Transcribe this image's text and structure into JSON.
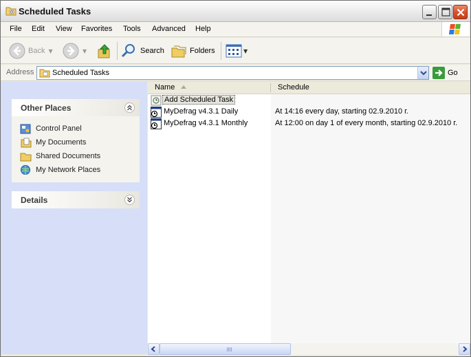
{
  "window": {
    "title": "Scheduled Tasks"
  },
  "menu": [
    "File",
    "Edit",
    "View",
    "Favorites",
    "Tools",
    "Advanced",
    "Help"
  ],
  "toolbar": {
    "back_label": "Back",
    "search_label": "Search",
    "folders_label": "Folders"
  },
  "address": {
    "label": "Address",
    "value": "Scheduled Tasks",
    "go_label": "Go"
  },
  "sidebar": {
    "other_places": {
      "title": "Other Places",
      "items": [
        {
          "label": "Control Panel",
          "icon": "control-panel-icon"
        },
        {
          "label": "My Documents",
          "icon": "my-documents-icon"
        },
        {
          "label": "Shared Documents",
          "icon": "folder-icon"
        },
        {
          "label": "My Network Places",
          "icon": "network-places-icon"
        }
      ]
    },
    "details": {
      "title": "Details"
    }
  },
  "list": {
    "columns": [
      "Name",
      "Schedule"
    ],
    "rows": [
      {
        "name": "Add Scheduled Task",
        "schedule": "",
        "icon": "add-task-icon"
      },
      {
        "name": "MyDefrag v4.3.1 Daily",
        "schedule": "At 14:16 every day, starting 02.9.2010 г.",
        "icon": "scheduled-task-icon"
      },
      {
        "name": "MyDefrag v4.3.1 Monthly",
        "schedule": "At 12:00 on day 1 of every month, starting 02.9.2010 г.",
        "icon": "scheduled-task-icon"
      }
    ]
  },
  "colors": {
    "sidebar_bg": "#d6dff7",
    "chrome_bg": "#f4f3ee",
    "close_red": "#d9532b"
  }
}
